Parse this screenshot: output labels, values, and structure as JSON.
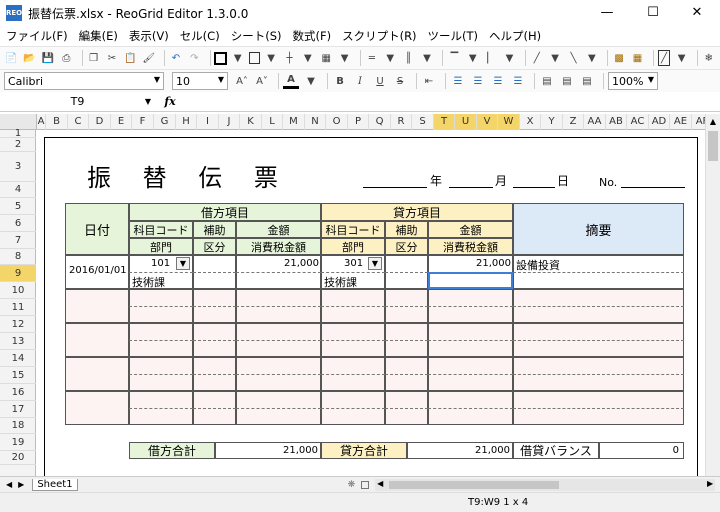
{
  "window": {
    "title": "振替伝票.xlsx - ReoGrid Editor 1.3.0.0",
    "app_icon_text": "REO"
  },
  "menu": [
    "ファイル(F)",
    "編集(E)",
    "表示(V)",
    "セル(C)",
    "シート(S)",
    "数式(F)",
    "スクリプト(R)",
    "ツール(T)",
    "ヘルプ(H)"
  ],
  "format": {
    "font_name": "Calibri",
    "font_size": "10",
    "zoom": "100%"
  },
  "formula_bar": {
    "address": "T9",
    "fx": "fx",
    "value": ""
  },
  "columns": [
    "A",
    "B",
    "C",
    "D",
    "E",
    "F",
    "G",
    "H",
    "I",
    "J",
    "K",
    "L",
    "M",
    "N",
    "O",
    "P",
    "Q",
    "R",
    "S",
    "T",
    "U",
    "V",
    "W",
    "X",
    "Y",
    "Z",
    "AA",
    "AB",
    "AC",
    "AD",
    "AE",
    "AF"
  ],
  "rows": [
    "1",
    "2",
    "3",
    "4",
    "5",
    "6",
    "7",
    "8",
    "9",
    "10",
    "11",
    "12",
    "13",
    "14",
    "15",
    "16",
    "17",
    "18",
    "19",
    "20"
  ],
  "voucher": {
    "title": "振 替 伝 票",
    "year": "年",
    "month": "月",
    "day": "日",
    "no": "No.",
    "date_header": "日付",
    "debit_header": "借方項目",
    "credit_header": "貸方項目",
    "memo_header": "摘要",
    "account_code": "科目コード",
    "sub": "補助",
    "amount": "金額",
    "dept": "部門",
    "division": "区分",
    "tax": "消費税金額",
    "date": "2016/01/01",
    "debit_code": "101",
    "debit_amount": "21,000",
    "debit_dept": "技術課",
    "credit_code": "301",
    "credit_amount": "21,000",
    "credit_dept": "技術課",
    "memo": "設備投資",
    "debit_total_label": "借方合計",
    "debit_total": "21,000",
    "credit_total_label": "貸方合計",
    "credit_total": "21,000",
    "balance_label": "借貸バランス",
    "balance": "0"
  },
  "sheet_tab": "Sheet1",
  "status": "T9:W9 1 x 4"
}
